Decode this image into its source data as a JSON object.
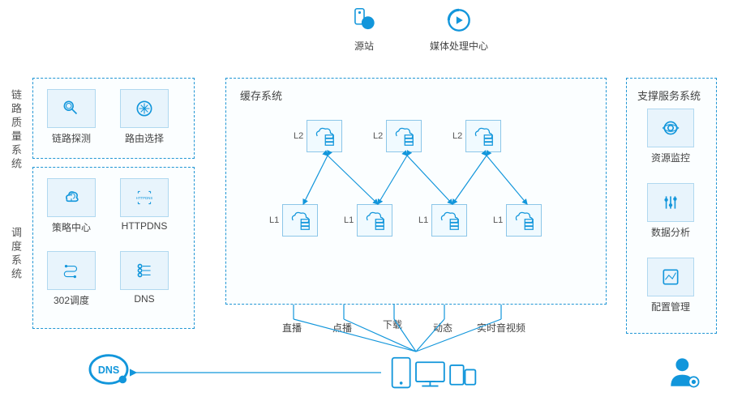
{
  "top": {
    "origin": "源站",
    "media": "媒体处理中心"
  },
  "left": {
    "quality_title": "链路质量系统",
    "sched_title": "调度系统",
    "items": {
      "probe": "链路探测",
      "route": "路由选择",
      "policy": "策略中心",
      "httpdns": "HTTPDNS",
      "r302": "302调度",
      "dns": "DNS"
    },
    "dns_node": "DNS"
  },
  "center": {
    "title": "缓存系统",
    "l2": "L2",
    "l1": "L1",
    "services": [
      "直播",
      "点播",
      "下载",
      "动态",
      "实时音视频"
    ]
  },
  "right": {
    "title": "支撑服务系统",
    "items": {
      "monitor": "资源监控",
      "analysis": "数据分析",
      "config": "配置管理"
    }
  },
  "colors": {
    "primary": "#1296db"
  }
}
